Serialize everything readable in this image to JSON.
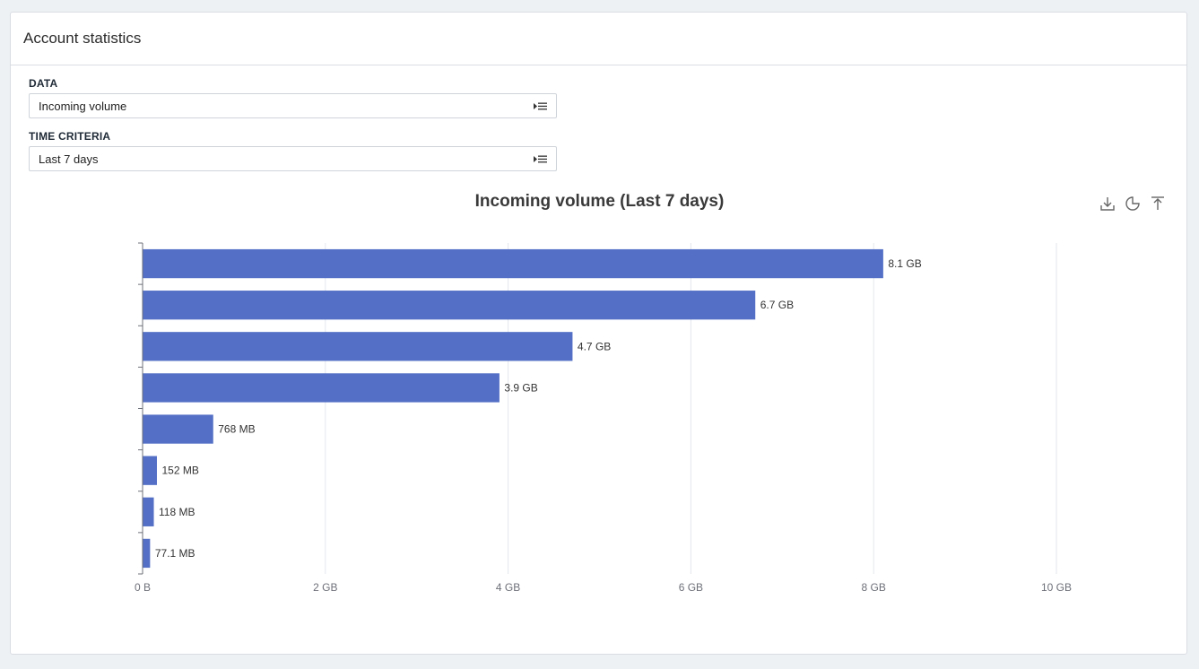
{
  "panel": {
    "title": "Account statistics"
  },
  "filters": {
    "data": {
      "label": "DATA",
      "value": "Incoming volume"
    },
    "time": {
      "label": "TIME CRITERIA",
      "value": "Last 7 days"
    }
  },
  "toolbar": {
    "download_icon": "download-icon",
    "pie_icon": "pie-chart-icon",
    "sort_icon": "sort-top-icon"
  },
  "colors": {
    "bar": "#5470c6",
    "grid": "#e3e6ec",
    "axis": "#6e7079"
  },
  "chart_data": {
    "type": "bar",
    "orientation": "horizontal",
    "title": "Incoming volume (Last 7 days)",
    "categories": [
      "",
      "",
      "",
      "",
      "",
      "",
      "",
      ""
    ],
    "values": [
      8.1,
      6.7,
      4.7,
      3.9,
      0.768,
      0.152,
      0.118,
      0.0771
    ],
    "value_unit": "GB",
    "data_labels": [
      "8.1 GB",
      "6.7 GB",
      "4.7 GB",
      "3.9 GB",
      "768 MB",
      "152 MB",
      "118 MB",
      "77.1 MB"
    ],
    "xlim": [
      0,
      10
    ],
    "xticks": [
      0,
      2,
      4,
      6,
      8,
      10
    ],
    "xtick_labels": [
      "0 B",
      "2 GB",
      "4 GB",
      "6 GB",
      "8 GB",
      "10 GB"
    ],
    "grid": true
  }
}
